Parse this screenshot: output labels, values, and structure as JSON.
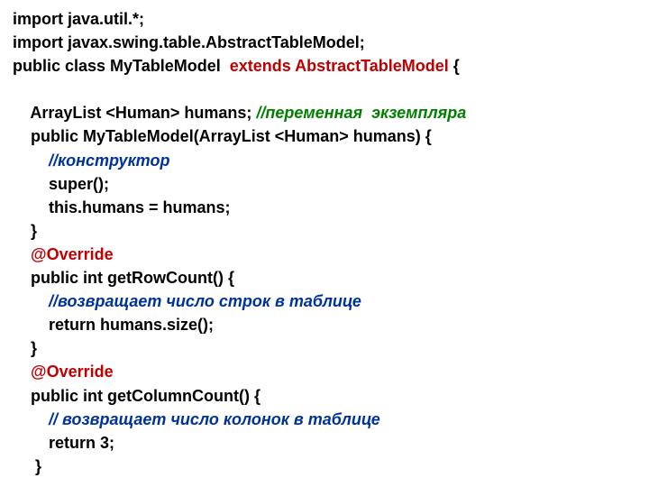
{
  "lines": [
    {
      "i": 0,
      "segs": [
        {
          "t": "import java.util.*;",
          "c": ""
        }
      ]
    },
    {
      "i": 0,
      "segs": [
        {
          "t": "import javax.swing.table.AbstractTableModel;",
          "c": ""
        }
      ]
    },
    {
      "i": 0,
      "segs": [
        {
          "t": "public class MyTableModel  ",
          "c": ""
        },
        {
          "t": "extends AbstractTableModel",
          "c": "red"
        },
        {
          "t": " {",
          "c": ""
        }
      ]
    },
    {
      "i": 0,
      "segs": [
        {
          "t": " ",
          "c": ""
        }
      ]
    },
    {
      "i": 1,
      "segs": [
        {
          "t": "ArrayList <Human> humans; ",
          "c": ""
        },
        {
          "t": "//переменная  экземпляра",
          "c": "green"
        }
      ]
    },
    {
      "i": 1,
      "segs": [
        {
          "t": "public MyTableModel(ArrayList <Human> humans) {",
          "c": ""
        }
      ]
    },
    {
      "i": 2,
      "segs": [
        {
          "t": "//конструктор",
          "c": "blue"
        }
      ]
    },
    {
      "i": 2,
      "segs": [
        {
          "t": "super();",
          "c": ""
        }
      ]
    },
    {
      "i": 2,
      "segs": [
        {
          "t": "this.humans = humans;",
          "c": ""
        }
      ]
    },
    {
      "i": 1,
      "segs": [
        {
          "t": "}",
          "c": ""
        }
      ]
    },
    {
      "i": 1,
      "segs": [
        {
          "t": "@Override",
          "c": "red"
        }
      ]
    },
    {
      "i": 1,
      "segs": [
        {
          "t": "public int getRowCount() {",
          "c": ""
        }
      ]
    },
    {
      "i": 2,
      "segs": [
        {
          "t": "//возвращает число строк в таблице",
          "c": "blue"
        }
      ]
    },
    {
      "i": 2,
      "segs": [
        {
          "t": "return humans.size();",
          "c": ""
        }
      ]
    },
    {
      "i": 1,
      "segs": [
        {
          "t": "}",
          "c": ""
        }
      ]
    },
    {
      "i": 1,
      "segs": [
        {
          "t": "@Override",
          "c": "red"
        }
      ]
    },
    {
      "i": 1,
      "segs": [
        {
          "t": "public int getColumnCount() {",
          "c": ""
        }
      ]
    },
    {
      "i": 2,
      "segs": [
        {
          "t": "// возвращает число колонок в таблице",
          "c": "blue"
        }
      ]
    },
    {
      "i": 2,
      "segs": [
        {
          "t": "return 3;",
          "c": ""
        }
      ]
    },
    {
      "i": 1,
      "segs": [
        {
          "t": " }",
          "c": ""
        }
      ]
    }
  ],
  "indent_unit": "    "
}
